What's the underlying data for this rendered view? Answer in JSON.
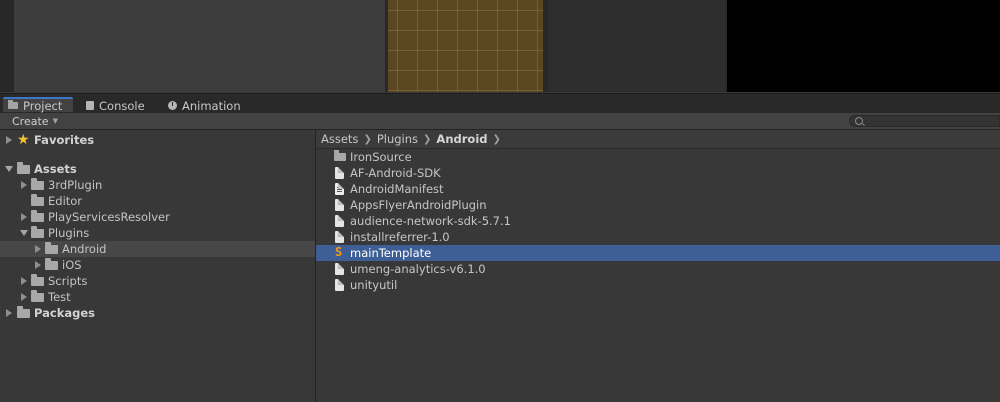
{
  "tabs": [
    {
      "label": "Project",
      "icon": "folder-icon",
      "active": true
    },
    {
      "label": "Console",
      "icon": "console-icon",
      "active": false
    },
    {
      "label": "Animation",
      "icon": "animation-icon",
      "active": false
    }
  ],
  "toolbar": {
    "create_label": "Create",
    "search_placeholder": ""
  },
  "tree": {
    "favorites": "Favorites",
    "assets": "Assets",
    "children": [
      "3rdPlugin",
      "Editor",
      "PlayServicesResolver",
      "Plugins"
    ],
    "plugins_children": [
      "Android",
      "iOS"
    ],
    "more": [
      "Scripts",
      "Test"
    ],
    "packages": "Packages"
  },
  "breadcrumb": [
    "Assets",
    "Plugins",
    "Android"
  ],
  "assets": [
    {
      "label": "IronSource",
      "icon": "folder-icon"
    },
    {
      "label": "AF-Android-SDK",
      "icon": "file-icon"
    },
    {
      "label": "AndroidManifest",
      "icon": "manifest-icon"
    },
    {
      "label": "AppsFlyerAndroidPlugin",
      "icon": "file-icon"
    },
    {
      "label": "audience-network-sdk-5.7.1",
      "icon": "file-icon"
    },
    {
      "label": "installreferrer-1.0",
      "icon": "file-icon"
    },
    {
      "label": "mainTemplate",
      "icon": "sublime-icon",
      "selected": true
    },
    {
      "label": "umeng-analytics-v6.1.0",
      "icon": "file-icon"
    },
    {
      "label": "unityutil",
      "icon": "file-icon"
    }
  ],
  "colors": {
    "selection": "#3e5f96",
    "tab_accent": "#3d77c6",
    "favorites_star": "#f1c232"
  }
}
